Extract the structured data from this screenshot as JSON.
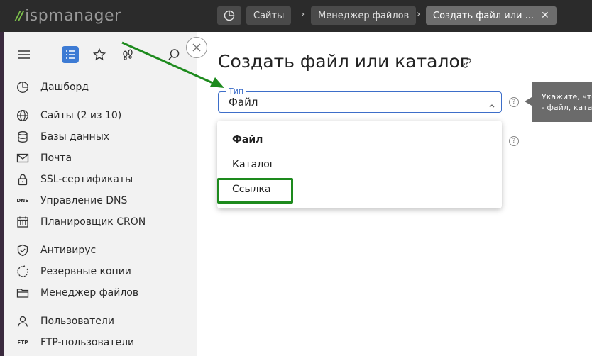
{
  "app": {
    "logo_mark": "//",
    "logo_text": "ispmanager"
  },
  "breadcrumbs": [
    {
      "label": "Сайты"
    },
    {
      "label": "Менеджер файлов"
    },
    {
      "label": "Создать файл или ...",
      "close": "✕"
    }
  ],
  "sidebar": {
    "tools": [
      "menu-icon",
      "list-icon",
      "star-icon",
      "footprint-icon",
      "search-icon"
    ],
    "items": [
      {
        "label": "Дашборд",
        "icon": "dashboard-icon"
      },
      {
        "label": "Сайты (2 из 10)",
        "icon": "globe-icon"
      },
      {
        "label": "Базы данных",
        "icon": "database-icon"
      },
      {
        "label": "Почта",
        "icon": "mail-icon"
      },
      {
        "label": "SSL-сертификаты",
        "icon": "lock-icon"
      },
      {
        "label": "Управление DNS",
        "icon": "dns-icon",
        "icon_text": "DNS"
      },
      {
        "label": "Планировщик CRON",
        "icon": "calendar-icon"
      },
      {
        "label": "Антивирус",
        "icon": "shield-icon"
      },
      {
        "label": "Резервные копии",
        "icon": "backup-icon"
      },
      {
        "label": "Менеджер файлов",
        "icon": "folder-icon"
      },
      {
        "label": "Пользователи",
        "icon": "user-icon"
      },
      {
        "label": "FTP-пользователи",
        "icon": "ftp-icon",
        "icon_text": "FTP"
      }
    ]
  },
  "main": {
    "title": "Создать файл или каталог",
    "type_field": {
      "legend": "Тип",
      "value": "Файл"
    },
    "tooltip": {
      "line1": "Укажите, что",
      "line2": "- файл, катал"
    },
    "dropdown_options": [
      {
        "label": "Файл",
        "selected": true
      },
      {
        "label": "Каталог",
        "selected": false
      },
      {
        "label": "Ссылка",
        "selected": false
      }
    ]
  },
  "colors": {
    "accent": "#3d7bd4",
    "highlight": "#1d8a1d",
    "topbar": "#2b2b2b"
  }
}
